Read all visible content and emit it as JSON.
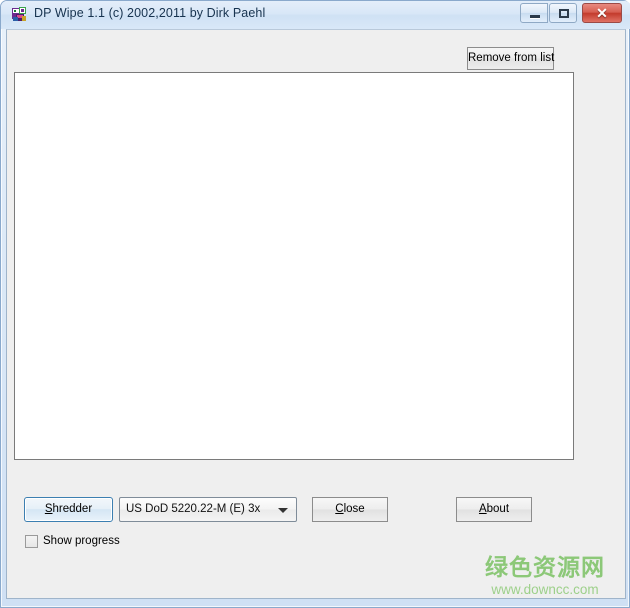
{
  "window": {
    "title": "DP Wipe 1.1 (c) 2002,2011 by Dirk Paehl",
    "icon": "app-icon",
    "controls": {
      "minimize_label": "–",
      "maximize_label": "□",
      "close_label": "✕"
    }
  },
  "toolbar": {
    "remove_from_list_label": "Remove from list"
  },
  "filelist": {
    "items": [],
    "empty_text": ""
  },
  "actions": {
    "shredder_label": "Shredder",
    "shredder_accel": "S",
    "close_label": "Close",
    "close_accel": "C",
    "about_label": "About",
    "about_accel": "A"
  },
  "method": {
    "selected": "US DoD 5220.22-M (E) 3x",
    "arrow_icon": "chevron-down-icon"
  },
  "options": {
    "show_progress_label": "Show progress",
    "show_progress_checked": false
  },
  "watermark": {
    "chinese": "绿色资源网",
    "url": "www.downcc.com",
    "color": "#8cc878"
  },
  "colors": {
    "titlebar": "#d8e7f7",
    "client": "#efefef",
    "close_button": "#c33b2c",
    "focus_border": "#3c7fb1",
    "list_background": "#ffffff"
  }
}
